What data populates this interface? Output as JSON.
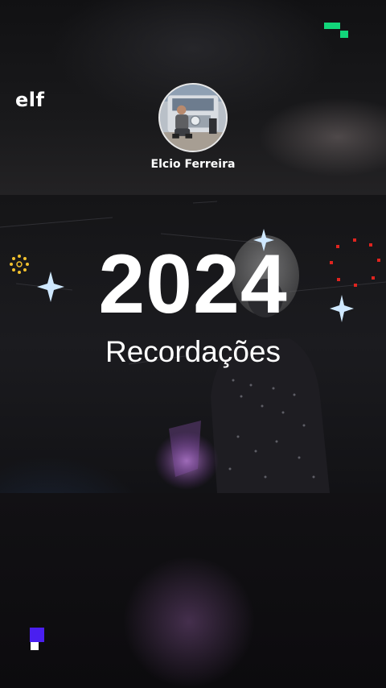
{
  "header": {
    "brand_text": "elf",
    "channel_name": "Elcio Ferreira",
    "logo_icon": "pixel-blocks-icon",
    "logo_color": "#12d67a"
  },
  "video": {
    "year": "2024",
    "subtitle": "Recordações"
  },
  "footer": {
    "badge_icon": "pixel-square-icon",
    "badge_color": "#4a1ff0"
  }
}
